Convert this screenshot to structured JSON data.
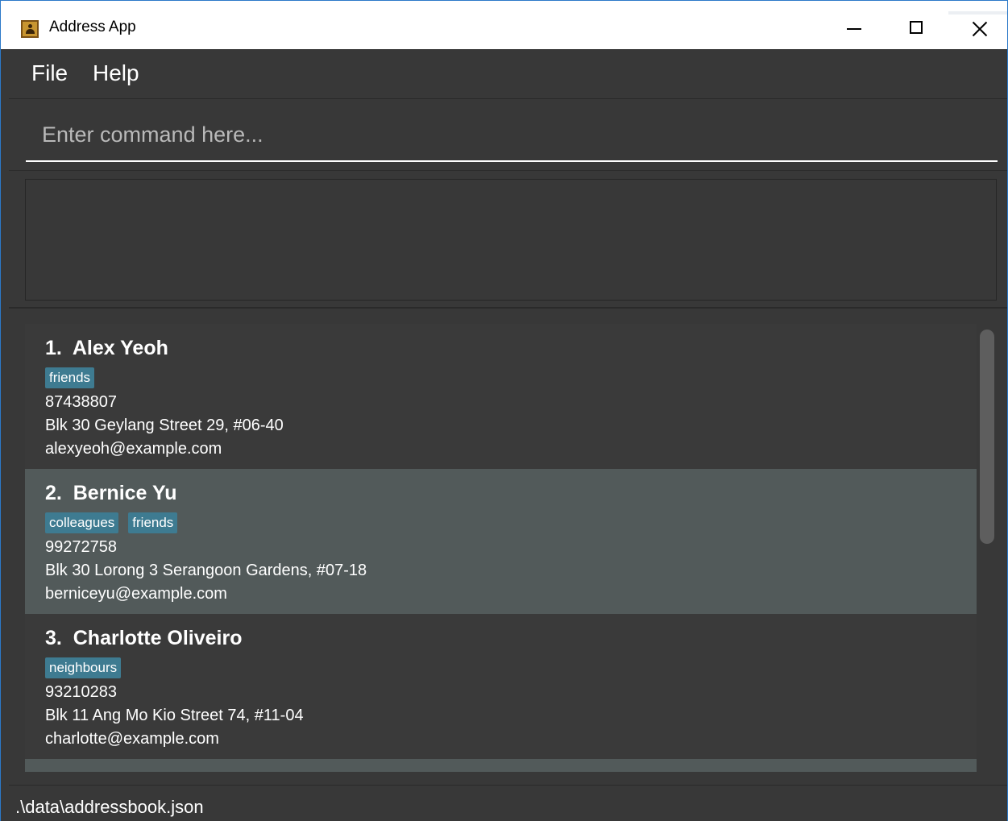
{
  "window": {
    "title": "Address App",
    "app_icon": "address-book-icon"
  },
  "menu": {
    "items": [
      "File",
      "Help"
    ]
  },
  "command": {
    "placeholder": "Enter command here..."
  },
  "result": {
    "text": ""
  },
  "persons": [
    {
      "index": "1.",
      "name": "Alex Yeoh",
      "tags": [
        "friends"
      ],
      "phone": "87438807",
      "address": "Blk 30 Geylang Street 29, #06-40",
      "email": "alexyeoh@example.com",
      "selected": false
    },
    {
      "index": "2.",
      "name": "Bernice Yu",
      "tags": [
        "colleagues",
        "friends"
      ],
      "phone": "99272758",
      "address": "Blk 30 Lorong 3 Serangoon Gardens, #07-18",
      "email": "berniceyu@example.com",
      "selected": true
    },
    {
      "index": "3.",
      "name": "Charlotte Oliveiro",
      "tags": [
        "neighbours"
      ],
      "phone": "93210283",
      "address": "Blk 11 Ang Mo Kio Street 74, #11-04",
      "email": "charlotte@example.com",
      "selected": false
    }
  ],
  "status": {
    "file_path": ".\\data\\addressbook.json"
  },
  "colors": {
    "background": "#383838",
    "selected_card": "#525a5a",
    "tag": "#3e7b91",
    "title_bar_border": "#2b79c8"
  }
}
